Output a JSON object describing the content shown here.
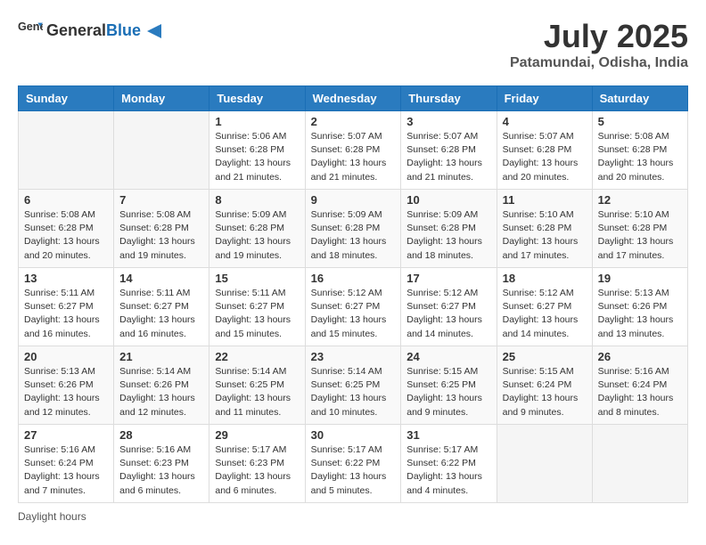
{
  "header": {
    "logo_general": "General",
    "logo_blue": "Blue",
    "main_title": "July 2025",
    "subtitle": "Patamundai, Odisha, India"
  },
  "calendar": {
    "weekdays": [
      "Sunday",
      "Monday",
      "Tuesday",
      "Wednesday",
      "Thursday",
      "Friday",
      "Saturday"
    ],
    "weeks": [
      [
        {
          "day": "",
          "info": ""
        },
        {
          "day": "",
          "info": ""
        },
        {
          "day": "1",
          "info": "Sunrise: 5:06 AM\nSunset: 6:28 PM\nDaylight: 13 hours and 21 minutes."
        },
        {
          "day": "2",
          "info": "Sunrise: 5:07 AM\nSunset: 6:28 PM\nDaylight: 13 hours and 21 minutes."
        },
        {
          "day": "3",
          "info": "Sunrise: 5:07 AM\nSunset: 6:28 PM\nDaylight: 13 hours and 21 minutes."
        },
        {
          "day": "4",
          "info": "Sunrise: 5:07 AM\nSunset: 6:28 PM\nDaylight: 13 hours and 20 minutes."
        },
        {
          "day": "5",
          "info": "Sunrise: 5:08 AM\nSunset: 6:28 PM\nDaylight: 13 hours and 20 minutes."
        }
      ],
      [
        {
          "day": "6",
          "info": "Sunrise: 5:08 AM\nSunset: 6:28 PM\nDaylight: 13 hours and 20 minutes."
        },
        {
          "day": "7",
          "info": "Sunrise: 5:08 AM\nSunset: 6:28 PM\nDaylight: 13 hours and 19 minutes."
        },
        {
          "day": "8",
          "info": "Sunrise: 5:09 AM\nSunset: 6:28 PM\nDaylight: 13 hours and 19 minutes."
        },
        {
          "day": "9",
          "info": "Sunrise: 5:09 AM\nSunset: 6:28 PM\nDaylight: 13 hours and 18 minutes."
        },
        {
          "day": "10",
          "info": "Sunrise: 5:09 AM\nSunset: 6:28 PM\nDaylight: 13 hours and 18 minutes."
        },
        {
          "day": "11",
          "info": "Sunrise: 5:10 AM\nSunset: 6:28 PM\nDaylight: 13 hours and 17 minutes."
        },
        {
          "day": "12",
          "info": "Sunrise: 5:10 AM\nSunset: 6:28 PM\nDaylight: 13 hours and 17 minutes."
        }
      ],
      [
        {
          "day": "13",
          "info": "Sunrise: 5:11 AM\nSunset: 6:27 PM\nDaylight: 13 hours and 16 minutes."
        },
        {
          "day": "14",
          "info": "Sunrise: 5:11 AM\nSunset: 6:27 PM\nDaylight: 13 hours and 16 minutes."
        },
        {
          "day": "15",
          "info": "Sunrise: 5:11 AM\nSunset: 6:27 PM\nDaylight: 13 hours and 15 minutes."
        },
        {
          "day": "16",
          "info": "Sunrise: 5:12 AM\nSunset: 6:27 PM\nDaylight: 13 hours and 15 minutes."
        },
        {
          "day": "17",
          "info": "Sunrise: 5:12 AM\nSunset: 6:27 PM\nDaylight: 13 hours and 14 minutes."
        },
        {
          "day": "18",
          "info": "Sunrise: 5:12 AM\nSunset: 6:27 PM\nDaylight: 13 hours and 14 minutes."
        },
        {
          "day": "19",
          "info": "Sunrise: 5:13 AM\nSunset: 6:26 PM\nDaylight: 13 hours and 13 minutes."
        }
      ],
      [
        {
          "day": "20",
          "info": "Sunrise: 5:13 AM\nSunset: 6:26 PM\nDaylight: 13 hours and 12 minutes."
        },
        {
          "day": "21",
          "info": "Sunrise: 5:14 AM\nSunset: 6:26 PM\nDaylight: 13 hours and 12 minutes."
        },
        {
          "day": "22",
          "info": "Sunrise: 5:14 AM\nSunset: 6:25 PM\nDaylight: 13 hours and 11 minutes."
        },
        {
          "day": "23",
          "info": "Sunrise: 5:14 AM\nSunset: 6:25 PM\nDaylight: 13 hours and 10 minutes."
        },
        {
          "day": "24",
          "info": "Sunrise: 5:15 AM\nSunset: 6:25 PM\nDaylight: 13 hours and 9 minutes."
        },
        {
          "day": "25",
          "info": "Sunrise: 5:15 AM\nSunset: 6:24 PM\nDaylight: 13 hours and 9 minutes."
        },
        {
          "day": "26",
          "info": "Sunrise: 5:16 AM\nSunset: 6:24 PM\nDaylight: 13 hours and 8 minutes."
        }
      ],
      [
        {
          "day": "27",
          "info": "Sunrise: 5:16 AM\nSunset: 6:24 PM\nDaylight: 13 hours and 7 minutes."
        },
        {
          "day": "28",
          "info": "Sunrise: 5:16 AM\nSunset: 6:23 PM\nDaylight: 13 hours and 6 minutes."
        },
        {
          "day": "29",
          "info": "Sunrise: 5:17 AM\nSunset: 6:23 PM\nDaylight: 13 hours and 6 minutes."
        },
        {
          "day": "30",
          "info": "Sunrise: 5:17 AM\nSunset: 6:22 PM\nDaylight: 13 hours and 5 minutes."
        },
        {
          "day": "31",
          "info": "Sunrise: 5:17 AM\nSunset: 6:22 PM\nDaylight: 13 hours and 4 minutes."
        },
        {
          "day": "",
          "info": ""
        },
        {
          "day": "",
          "info": ""
        }
      ]
    ]
  },
  "footer": {
    "daylight_label": "Daylight hours"
  }
}
